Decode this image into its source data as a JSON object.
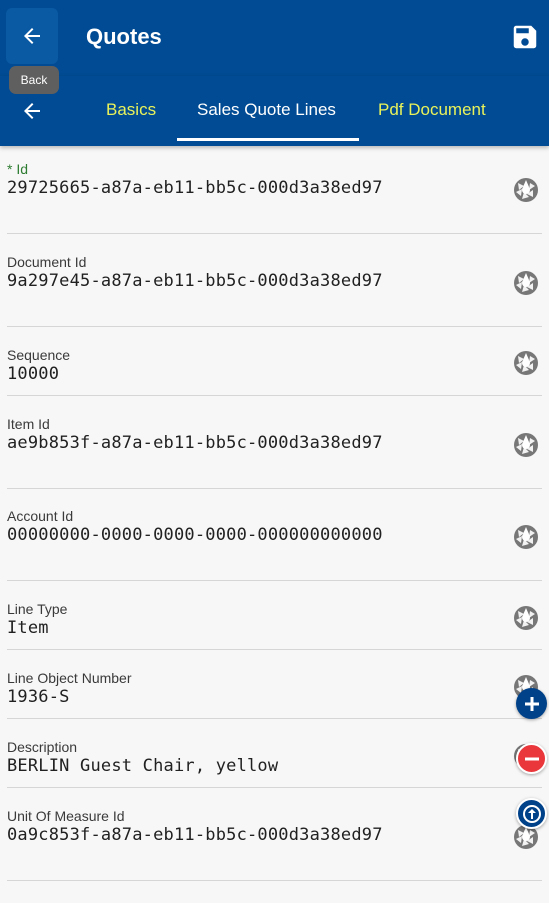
{
  "header": {
    "title": "Quotes",
    "back_tooltip": "Back"
  },
  "tabs": [
    {
      "label": "Basics"
    },
    {
      "label": "Sales Quote Lines"
    },
    {
      "label": "Pdf Document"
    }
  ],
  "fields": [
    {
      "label": "* Id",
      "value": "29725665-a87a-eb11-bb5c-000d3a38ed97"
    },
    {
      "label": "Document Id",
      "value": "9a297e45-a87a-eb11-bb5c-000d3a38ed97"
    },
    {
      "label": "Sequence",
      "value": "10000"
    },
    {
      "label": "Item Id",
      "value": "ae9b853f-a87a-eb11-bb5c-000d3a38ed97"
    },
    {
      "label": "Account Id",
      "value": "00000000-0000-0000-0000-000000000000"
    },
    {
      "label": "Line Type",
      "value": "Item"
    },
    {
      "label": "Line Object Number",
      "value": "1936-S"
    },
    {
      "label": "Description",
      "value": "BERLIN Guest Chair, yellow"
    },
    {
      "label": "Unit Of Measure Id",
      "value": "0a9c853f-a87a-eb11-bb5c-000d3a38ed97"
    }
  ],
  "colors": {
    "appbar": "#004b93",
    "tab_inactive": "#e9f25a",
    "required_label": "#2e7d32",
    "fab_primary": "#00428a",
    "fab_remove": "#e9373c"
  },
  "icons": {
    "back": "arrow-left-icon",
    "save": "floppy-disk-icon",
    "field_action": "aperture-icon",
    "add": "plus-icon",
    "remove": "minus-icon",
    "up": "arrow-up-icon"
  }
}
